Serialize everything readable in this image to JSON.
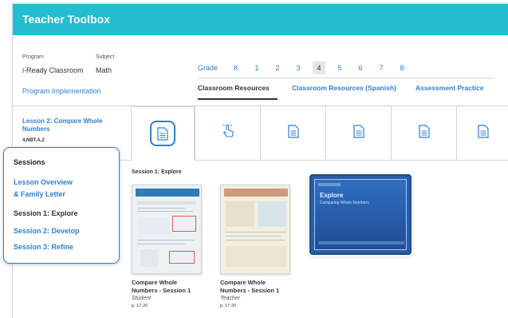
{
  "header": {
    "title": "Teacher Toolbox"
  },
  "program": {
    "label": "Program",
    "value": "i-Ready Classroom"
  },
  "subject": {
    "label": "Subject",
    "value": "Math"
  },
  "program_implementation": "Program Implementation",
  "grade": {
    "label": "Grade",
    "items": [
      "K",
      "1",
      "2",
      "3",
      "4",
      "5",
      "6",
      "7",
      "8"
    ],
    "selected": "4"
  },
  "resource_tabs": [
    "Classroom Resources",
    "Classroom Resources (Spanish)",
    "Assessment Practice"
  ],
  "lesson": {
    "title": "Lesson 2: Compare Whole Numbers",
    "code": "4.NBT.A.2"
  },
  "icon_tabs": [
    "document-icon",
    "tap-hand-icon",
    "document-icon",
    "document-icon",
    "document-icon",
    "document-icon"
  ],
  "sessions": {
    "heading": "Sessions",
    "items": [
      {
        "label": "Lesson Overview & Family Letter",
        "line1": "Lesson Overview",
        "line2": "& Family Letter"
      },
      {
        "label": "Session 1: Explore"
      },
      {
        "label": "Session 2: Develop"
      },
      {
        "label": "Session 3: Refine"
      }
    ],
    "current": "Session 1: Explore"
  },
  "content": {
    "session_heading": "Session 1: Explore",
    "resources": [
      {
        "title_line1": "Compare Whole",
        "title_line2": "Numbers - Session 1",
        "role": "Student",
        "pages": "p. 17-20"
      },
      {
        "title_line1": "Compare Whole",
        "title_line2": "Numbers - Session 1",
        "role": "Teacher",
        "pages": "p. 17-20"
      }
    ],
    "video": {
      "label": "Explore",
      "subtitle": "Comparing Whole Numbers"
    }
  },
  "colors": {
    "header": "#24bdd0",
    "link": "#2f7fd0",
    "text": "#333333"
  }
}
